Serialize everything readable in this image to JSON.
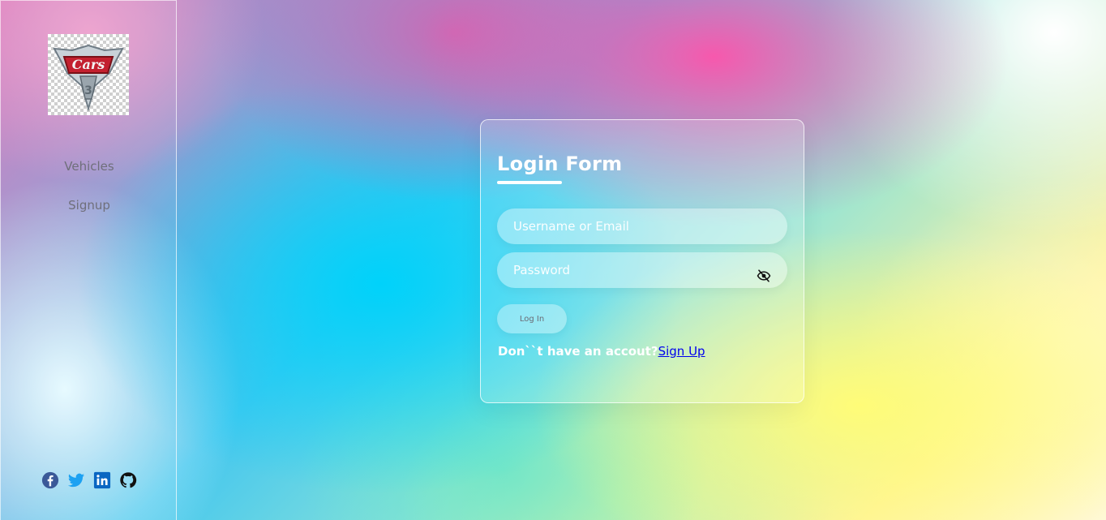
{
  "sidebar": {
    "logo_text": "Cars",
    "items": [
      {
        "label": "Vehicles"
      },
      {
        "label": "Signup"
      }
    ],
    "socials": [
      {
        "icon": "facebook-icon",
        "color": "#3b5998"
      },
      {
        "icon": "twitter-icon",
        "color": "#1da1f2"
      },
      {
        "icon": "linkedin-icon",
        "color": "#0a66c2"
      },
      {
        "icon": "github-icon",
        "color": "#111111"
      }
    ]
  },
  "form": {
    "title": "Login Form",
    "username_placeholder": "Username or Email",
    "password_placeholder": "Password",
    "eye_icon": "eye-slash-icon",
    "login_label": "Log In",
    "signup_prompt": "Don``t have an accout?",
    "signup_link": "Sign Up"
  },
  "colors": {
    "card_border": "#ffffff",
    "link": "#0000ee",
    "nav_text": "#6f6f7a"
  }
}
